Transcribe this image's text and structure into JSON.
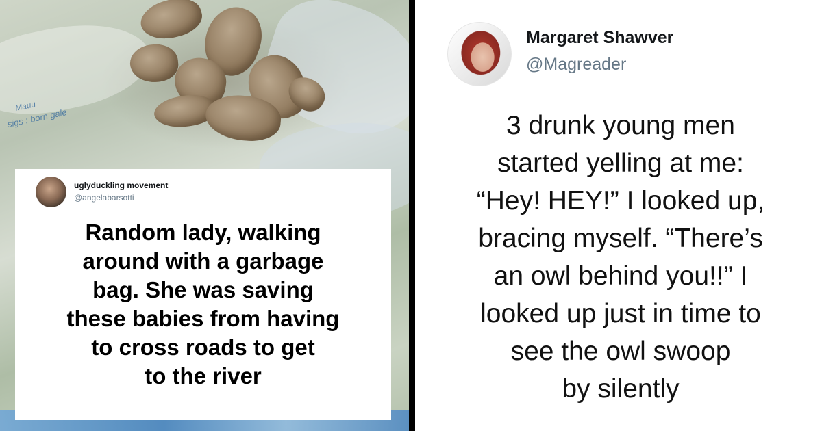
{
  "left_card": {
    "author_name": "uglyduckling movement",
    "author_handle": "@angelabarsotti",
    "text": "Random lady, walking\naround with a garbage\nbag. She was saving\nthese babies from having\nto cross roads to get\nto the river"
  },
  "right_tweet": {
    "author_name": "Margaret Shawver",
    "author_handle": "@Magreader",
    "text": "3 drunk young men\nstarted yelling at me:\n“Hey! HEY!” I looked up,\nbracing myself. “There’s\nan owl behind you!!” I\nlooked up just in time to\nsee the owl swoop\nby silently"
  },
  "photo": {
    "bag_print_1": "Mauu",
    "bag_print_2": "sigs : born gale"
  },
  "colors": {
    "handle_gray": "#657786",
    "name_black": "#14171a",
    "divider": "#000000",
    "bag_blue": "#3f7fbf"
  }
}
